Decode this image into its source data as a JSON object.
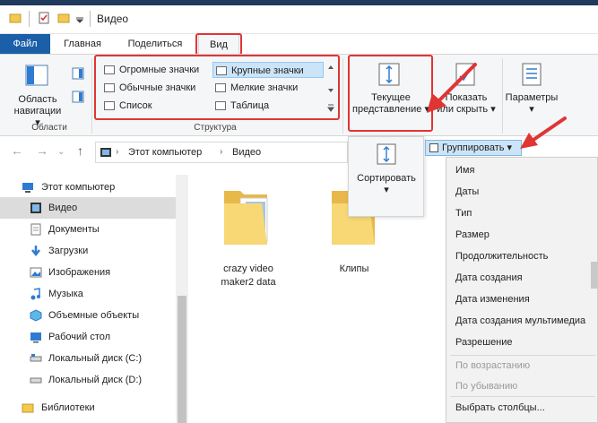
{
  "window": {
    "title": "Видео"
  },
  "menu": {
    "tabs": [
      {
        "label": "Файл"
      },
      {
        "label": "Главная"
      },
      {
        "label": "Поделиться"
      },
      {
        "label": "Вид"
      }
    ]
  },
  "ribbon": {
    "panes": {
      "nav_pane_line1": "Область",
      "nav_pane_line2": "навигации",
      "group_label": "Области"
    },
    "layout": {
      "items": [
        {
          "label": "Огромные значки"
        },
        {
          "label": "Крупные значки"
        },
        {
          "label": "Обычные значки"
        },
        {
          "label": "Мелкие значки"
        },
        {
          "label": "Список"
        },
        {
          "label": "Таблица"
        }
      ],
      "group_label": "Структура"
    },
    "current_view": {
      "line1": "Текущее",
      "line2": "представление"
    },
    "show_hide": {
      "line1": "Показать",
      "line2": "или скрыть"
    },
    "options": {
      "label": "Параметры"
    }
  },
  "sort_popup": {
    "sort_label": "Сортировать",
    "group_by_label": "Группировать"
  },
  "group_menu": {
    "items": [
      {
        "label": "Имя",
        "enabled": true
      },
      {
        "label": "Даты",
        "enabled": true
      },
      {
        "label": "Тип",
        "enabled": true
      },
      {
        "label": "Размер",
        "enabled": true
      },
      {
        "label": "Продолжительность",
        "enabled": true
      },
      {
        "label": "Дата создания",
        "enabled": true
      },
      {
        "label": "Дата изменения",
        "enabled": true
      },
      {
        "label": "Дата создания мультимедиа",
        "enabled": true
      },
      {
        "label": "Разрешение",
        "enabled": true
      },
      {
        "label": "По возрастанию",
        "enabled": false
      },
      {
        "label": "По убыванию",
        "enabled": false
      },
      {
        "label": "Выбрать столбцы...",
        "enabled": true
      }
    ]
  },
  "address": {
    "breadcrumb": [
      {
        "label": "Этот компьютер"
      },
      {
        "label": "Видео"
      }
    ]
  },
  "nav_pane": {
    "items": [
      {
        "label": "Этот компьютер",
        "icon": "computer-icon"
      },
      {
        "label": "Видео",
        "icon": "video-icon"
      },
      {
        "label": "Документы",
        "icon": "documents-icon"
      },
      {
        "label": "Загрузки",
        "icon": "downloads-icon"
      },
      {
        "label": "Изображения",
        "icon": "pictures-icon"
      },
      {
        "label": "Музыка",
        "icon": "music-icon"
      },
      {
        "label": "Объемные объекты",
        "icon": "3d-objects-icon"
      },
      {
        "label": "Рабочий стол",
        "icon": "desktop-icon"
      },
      {
        "label": "Локальный диск (C:)",
        "icon": "drive-icon"
      },
      {
        "label": "Локальный диск (D:)",
        "icon": "drive-icon"
      },
      {
        "label": "Библиотеки",
        "icon": "libraries-icon"
      }
    ]
  },
  "content": {
    "folders": [
      {
        "name_line1": "crazy video",
        "name_line2": "maker2 data"
      },
      {
        "name_line1": "Клипы",
        "name_line2": ""
      }
    ]
  },
  "colors": {
    "file_tab": "#1b5fa8",
    "highlight": "#e03535",
    "selection": "#cce4f7"
  }
}
